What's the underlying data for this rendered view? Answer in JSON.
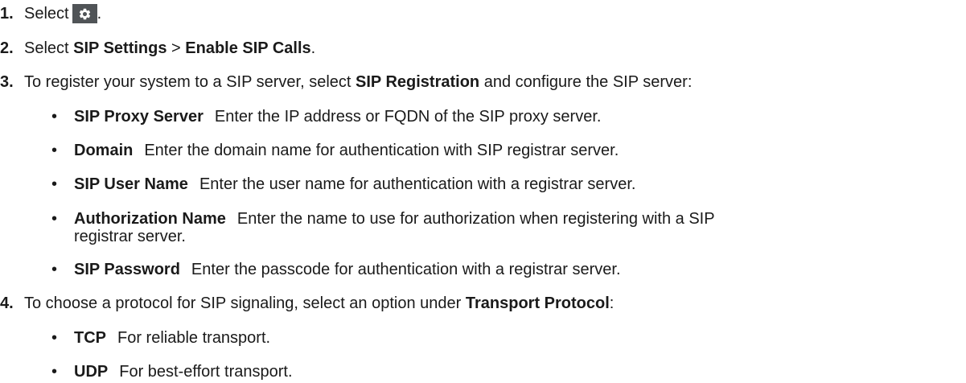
{
  "steps": {
    "s1": {
      "num": "1.",
      "pre": "Select",
      "post": ".",
      "icon": "gear-icon",
      "icon_bg": "#505457"
    },
    "s2": {
      "num": "2.",
      "pre": "Select",
      "b1": "SIP Settings",
      "mid": " > ",
      "b2": "Enable SIP Calls",
      "post": "."
    },
    "s3": {
      "num": "3.",
      "pre": "To register your system to a SIP server, select",
      "b1": "SIP Registration",
      "post": " and configure the SIP server:"
    },
    "s4": {
      "num": "4.",
      "pre": "To choose a protocol for SIP signaling, select an option under",
      "b1": "Transport Protocol",
      "post": ":"
    }
  },
  "registration_fields": [
    {
      "term": "SIP Proxy Server",
      "desc": "Enter the IP address or FQDN of the SIP proxy server."
    },
    {
      "term": "Domain",
      "desc": "Enter the domain name for authentication with SIP registrar server."
    },
    {
      "term": "SIP User Name",
      "desc": "Enter the user name for authentication with a registrar server."
    },
    {
      "term": "Authorization Name",
      "desc": "Enter the name to use for authorization when registering with a SIP",
      "desc_cont": "registrar server."
    },
    {
      "term": "SIP Password",
      "desc": "Enter the passcode for authentication with a registrar server."
    }
  ],
  "transport_options": [
    {
      "term": "TCP",
      "desc": "For reliable transport."
    },
    {
      "term": "UDP",
      "desc": "For best-effort transport."
    }
  ],
  "bullet_char": "•"
}
